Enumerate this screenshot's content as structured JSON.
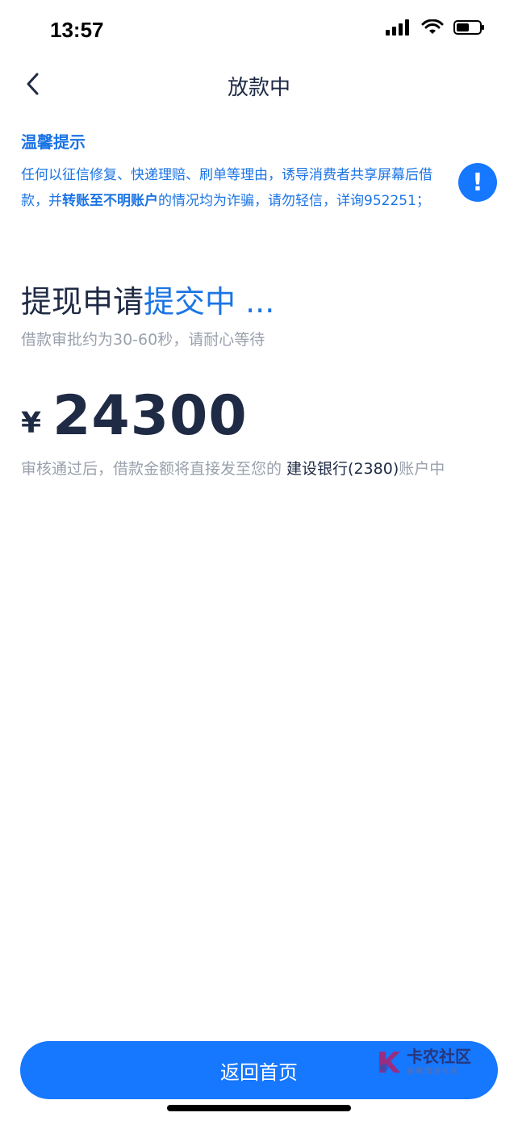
{
  "status_bar": {
    "time": "13:57"
  },
  "nav": {
    "title": "放款中"
  },
  "notice": {
    "title": "温馨提示",
    "text_part1": "任何以征信修复、快递理赔、刷单等理由，诱导消费者共享屏幕后借款，并",
    "text_bold": "转账至不明账户",
    "text_part2": "的情况均为诈骗，请勿轻信，详询952251；",
    "alert_symbol": "!"
  },
  "main": {
    "headline_black": "提现申请",
    "headline_blue": "提交中 ...",
    "sub_text": "借款审批约为30-60秒，请耐心等待",
    "currency": "¥",
    "amount": "24300",
    "pay_info_prefix": "审核通过后，借款金额将直接发至您的 ",
    "pay_info_bank": "建设银行(2380)",
    "pay_info_suffix": "账户中"
  },
  "bottom": {
    "home_button_label": "返回首页",
    "watermark_text": "卡农社区",
    "watermark_sub": "金融借贷社区"
  },
  "colors": {
    "accent": "#1677ff",
    "notice_text": "#1b74e4",
    "dark_text": "#1f2a44",
    "muted_text": "#9aa1ad"
  }
}
